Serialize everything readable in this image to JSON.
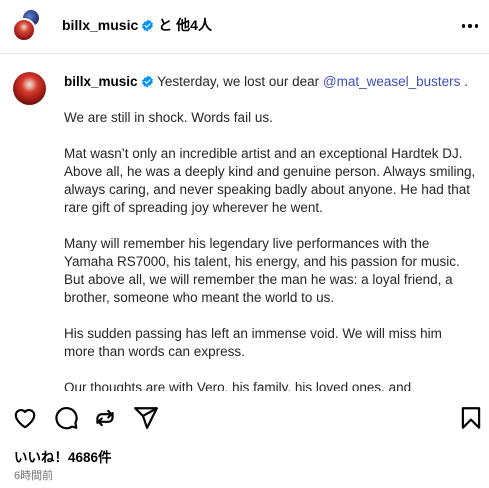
{
  "header": {
    "username": "billx_music",
    "with_text": "と 他4人",
    "more_icon": "more-horizontal-icon"
  },
  "post": {
    "username": "billx_music",
    "intro": "Yesterday, we lost our dear ",
    "mention": "@mat_weasel_busters",
    "intro_end": " .",
    "paragraphs": [
      "We are still in shock. Words fail us.",
      "Mat wasn’t only an incredible artist and an exceptional Hardtek DJ. Above all, he was a deeply kind and genuine person. Always smiling, always caring, and never speaking badly about anyone. He had that rare gift of spreading joy wherever he went.",
      "Many will remember his legendary live performances with the Yamaha RS7000, his talent, his energy, and his passion for music. But above all, we will remember the man he was: a loyal friend, a brother, someone who meant the world to us.",
      "His sudden passing has left an immense void. We will miss him more than words can express.",
      "Our thoughts are with Vero, his family, his loved ones, and"
    ]
  },
  "actions": {
    "like_icon": "heart-icon",
    "comment_icon": "comment-icon",
    "repost_icon": "repost-icon",
    "share_icon": "send-icon",
    "save_icon": "bookmark-icon"
  },
  "likes_text": "いいね！4686件",
  "time_text": "6時間前",
  "colors": {
    "verified": "#0095f6",
    "mention": "#3d4fbf",
    "secondary_text": "#737373"
  }
}
